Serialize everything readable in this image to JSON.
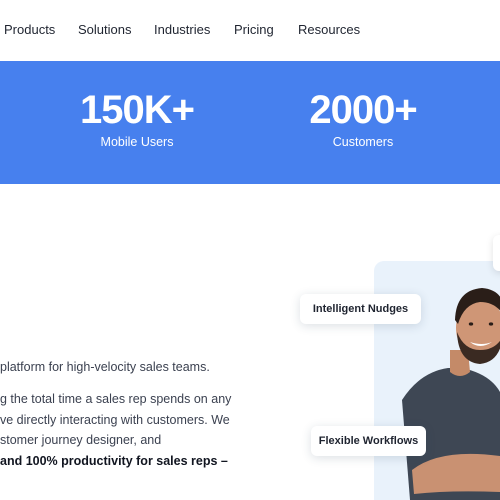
{
  "nav": {
    "items": [
      {
        "label": "Products"
      },
      {
        "label": "Solutions"
      },
      {
        "label": "Industries"
      },
      {
        "label": "Pricing"
      },
      {
        "label": "Resources"
      }
    ]
  },
  "stats": {
    "background": "#4780ee",
    "items": [
      {
        "value": "150K+",
        "label": "Mobile Users"
      },
      {
        "value": "2000+",
        "label": "Customers"
      }
    ]
  },
  "body": {
    "lines": [
      "platform for high-velocity sales teams.",
      "g the total time a sales rep spends on any",
      "ve directly interacting with customers. We",
      "stomer journey designer, and",
      "and 100% productivity for sales reps –"
    ]
  },
  "hero": {
    "chips": [
      {
        "label": "Intelligent Nudges"
      },
      {
        "label": "Flexible Workflows"
      }
    ]
  }
}
